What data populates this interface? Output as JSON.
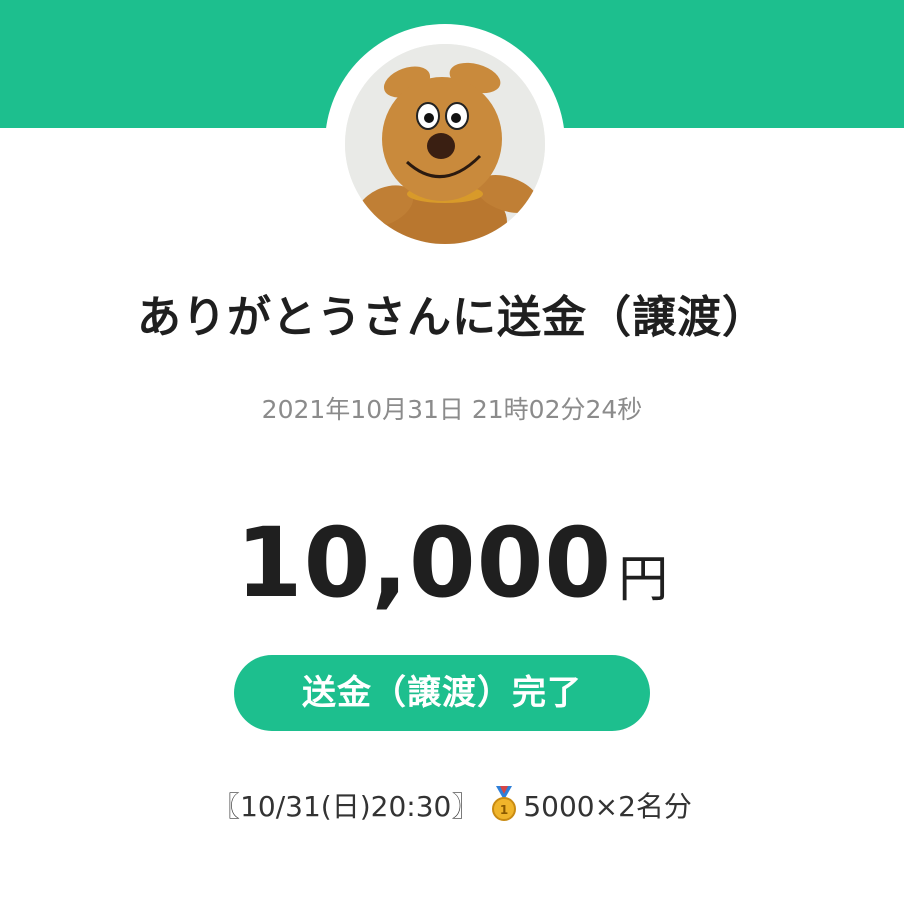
{
  "header": {
    "band_color": "#1dbf8e"
  },
  "recipient": {
    "avatar": "plush-dog-avatar",
    "title": "ありがとうさんに送金（譲渡）",
    "timestamp": "2021年10月31日 21時02分24秒"
  },
  "amount": {
    "value": "10,000",
    "unit": "円"
  },
  "status": {
    "label": "送金（譲渡）完了",
    "color": "#1dbf8e"
  },
  "memo": {
    "prefix": "〖10/31(日)20:30〗",
    "icon": "medal-icon",
    "suffix": "5000×2名分"
  }
}
